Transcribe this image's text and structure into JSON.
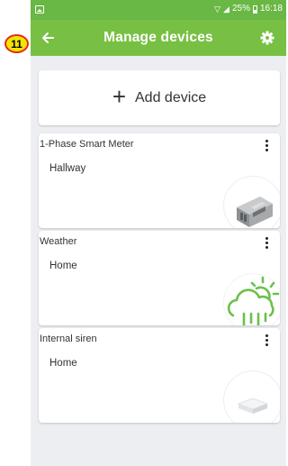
{
  "status_bar": {
    "time": "16:18",
    "battery_percent": "25%",
    "signal_icons": [
      "wifi-icon",
      "signal-icon"
    ]
  },
  "app_bar": {
    "title": "Manage devices",
    "back_icon": "back-arrow-icon",
    "settings_icon": "gear-icon"
  },
  "step_badge": "11",
  "add_device": {
    "label": "Add device",
    "icon": "plus-icon"
  },
  "devices": [
    {
      "name": "1-Phase Smart Meter",
      "location": "Hallway",
      "icon": "smart-meter-icon"
    },
    {
      "name": "Weather",
      "location": "Home",
      "icon": "weather-icon"
    },
    {
      "name": "Internal siren",
      "location": "Home",
      "icon": "siren-icon"
    }
  ],
  "colors": {
    "app_bar": "#78c043",
    "status_bar": "#69b744",
    "background": "#eceef1",
    "weather_icon": "#6cc04a",
    "badge_fill": "#f4e400",
    "badge_border": "#e52a1c"
  }
}
